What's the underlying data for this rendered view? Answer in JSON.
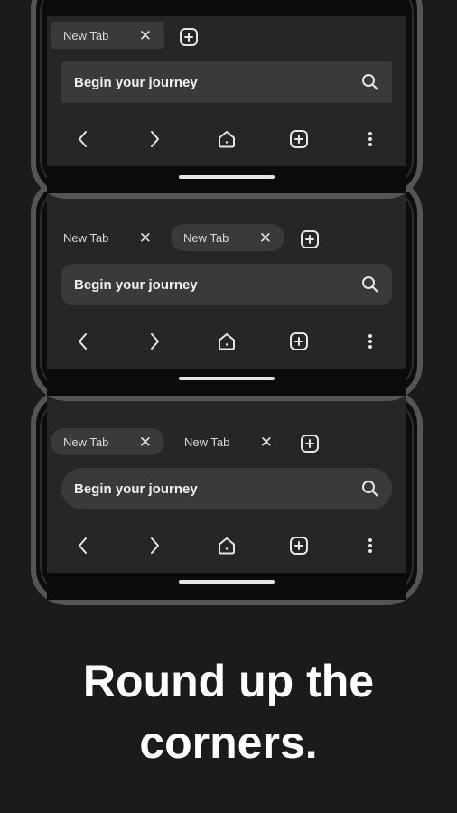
{
  "phones": [
    {
      "tabs": [
        {
          "label": "New Tab",
          "close": "✕",
          "active": true
        }
      ],
      "search": {
        "text": "Begin your journey"
      }
    },
    {
      "tabs": [
        {
          "label": "New Tab",
          "close": "✕",
          "active": false
        },
        {
          "label": "New Tab",
          "close": "✕",
          "active": true
        }
      ],
      "search": {
        "text": "Begin your journey"
      }
    },
    {
      "tabs": [
        {
          "label": "New Tab",
          "close": "✕",
          "active": true
        },
        {
          "label": "New Tab",
          "close": "✕",
          "active": false
        }
      ],
      "search": {
        "text": "Begin your journey"
      }
    }
  ],
  "icons": {
    "back": "chevron-left-icon",
    "forward": "chevron-right-icon",
    "home": "home-icon",
    "new_tab": "plus-square-icon",
    "menu": "more-vertical-icon",
    "search": "search-icon"
  },
  "headline": {
    "line1": "Round up the",
    "line2": "corners."
  }
}
